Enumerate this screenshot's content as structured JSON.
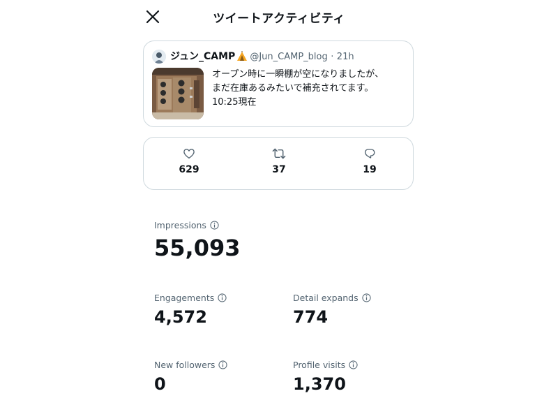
{
  "header": {
    "title": "ツイートアクティビティ",
    "close_icon": "close-icon"
  },
  "tweet": {
    "author_name": "ジュン_CAMP",
    "author_emoji_icon": "tent-icon",
    "handle": "@Jun_CAMP_blog",
    "separator": "·",
    "time": "21h",
    "text_lines": [
      "オープン時に一瞬棚が空になりましたが、",
      "まだ在庫あるみたいで補充されてます。",
      "10:25現在"
    ]
  },
  "engagement_counts": {
    "likes": {
      "icon": "heart-icon",
      "value": "629"
    },
    "retweets": {
      "icon": "retweet-icon",
      "value": "37"
    },
    "replies": {
      "icon": "reply-icon",
      "value": "19"
    }
  },
  "metrics": {
    "impressions": {
      "label": "Impressions",
      "value": "55,093"
    },
    "engagements": {
      "label": "Engagements",
      "value": "4,572"
    },
    "detail_expands": {
      "label": "Detail expands",
      "value": "774"
    },
    "new_followers": {
      "label": "New followers",
      "value": "0"
    },
    "profile_visits": {
      "label": "Profile visits",
      "value": "1,370"
    }
  },
  "colors": {
    "text_primary": "#0f1419",
    "text_secondary": "#536471",
    "border": "#cfd9de"
  }
}
